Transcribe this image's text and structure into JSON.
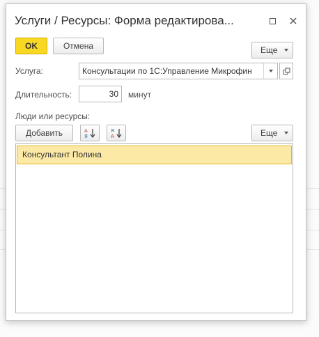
{
  "dialog": {
    "title": "Услуги / Ресурсы: Форма редактирова...",
    "ok_label": "OK",
    "cancel_label": "Отмена",
    "more_label": "Еще"
  },
  "form": {
    "service_label": "Услуга:",
    "service_value": "Консультации по 1С:Управление Микрофин",
    "duration_label": "Длительность:",
    "duration_value": "30",
    "duration_unit": "минут",
    "people_label": "Люди или ресурсы:"
  },
  "table_toolbar": {
    "add_label": "Добавить",
    "more_label": "Еще",
    "sort_asc_icon": "sort-ascending-icon",
    "sort_desc_icon": "sort-descending-icon"
  },
  "table": {
    "rows": [
      {
        "name": "Консультант Полина"
      }
    ]
  },
  "colors": {
    "accent_button": "#f9d824",
    "selected_row_bg": "#fbe9a5",
    "selected_row_border": "#e8b520"
  }
}
